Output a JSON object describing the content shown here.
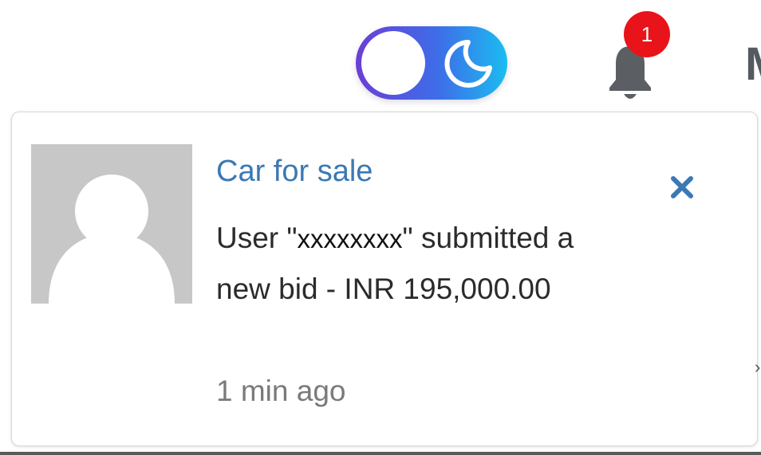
{
  "header": {
    "theme_toggle": {
      "state": "light",
      "icon": "moon-icon",
      "colors": {
        "from": "#6a3fd6",
        "to": "#1bbdf0"
      }
    },
    "notifications": {
      "icon": "bell-icon",
      "badge_count": "1",
      "badge_color": "#e8141a"
    },
    "cut_text": "M"
  },
  "notification": {
    "avatar": "user-placeholder-icon",
    "title": "Car for sale",
    "title_color": "#3a79b4",
    "message_prefix": "User \"",
    "username": "xxxxxxxx",
    "message_suffix": "\" submitted a new bid - INR 195,000.00",
    "time": "1 min ago",
    "close_icon": "close-icon"
  }
}
